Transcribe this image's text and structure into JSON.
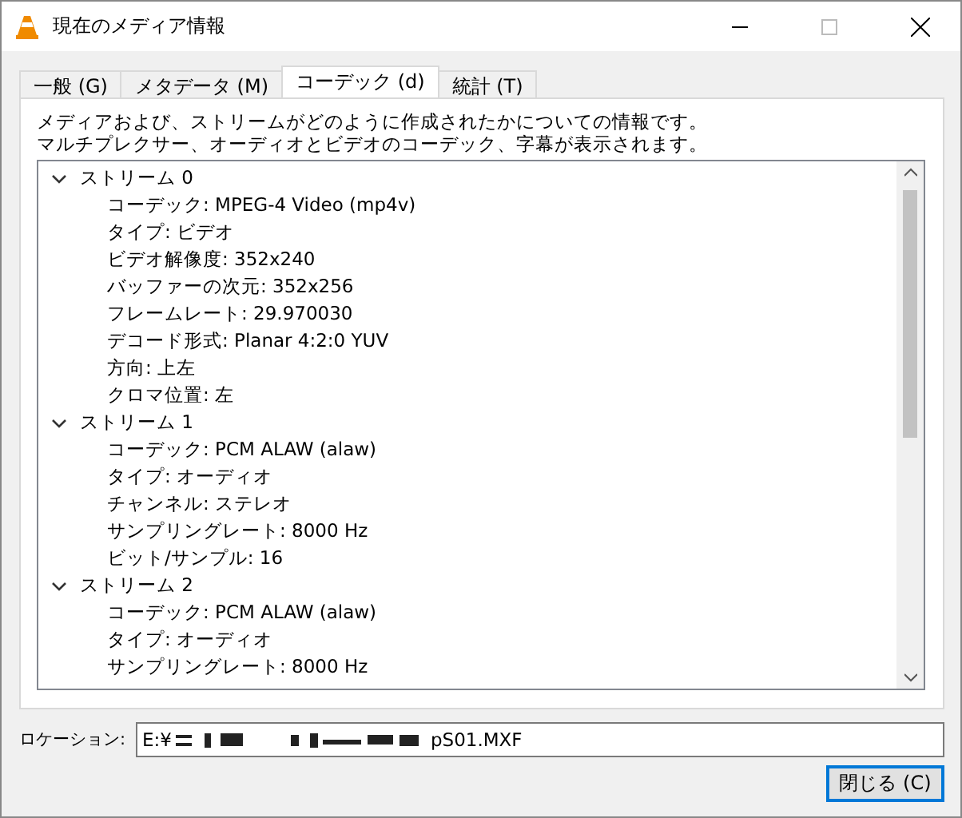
{
  "window": {
    "title": "現在のメディア情報"
  },
  "tabs": [
    {
      "label": "一般 (G)",
      "selected": false
    },
    {
      "label": "メタデータ (M)",
      "selected": false
    },
    {
      "label": "コーデック (d)",
      "selected": true
    },
    {
      "label": "統計 (T)",
      "selected": false
    }
  ],
  "description": [
    "メディアおよび、ストリームがどのように作成されたかについての情報です。",
    "マルチプレクサー、オーディオとビデオのコーデック、字幕が表示されます。"
  ],
  "tree": [
    {
      "label": "ストリーム 0",
      "expanded": true,
      "children": [
        {
          "label": "コーデック: MPEG-4 Video (mp4v)"
        },
        {
          "label": "タイプ: ビデオ"
        },
        {
          "label": "ビデオ解像度: 352x240"
        },
        {
          "label": "バッファーの次元: 352x256"
        },
        {
          "label": "フレームレート: 29.970030"
        },
        {
          "label": "デコード形式: Planar 4:2:0 YUV"
        },
        {
          "label": "方向: 上左"
        },
        {
          "label": "クロマ位置: 左"
        }
      ]
    },
    {
      "label": "ストリーム 1",
      "expanded": true,
      "children": [
        {
          "label": "コーデック: PCM ALAW (alaw)"
        },
        {
          "label": "タイプ: オーディオ"
        },
        {
          "label": "チャンネル: ステレオ"
        },
        {
          "label": "サンプリングレート: 8000 Hz"
        },
        {
          "label": "ビット/サンプル: 16"
        }
      ]
    },
    {
      "label": "ストリーム 2",
      "expanded": true,
      "children": [
        {
          "label": "コーデック: PCM ALAW (alaw)"
        },
        {
          "label": "タイプ: オーディオ"
        },
        {
          "label": "サンプリングレート: 8000 Hz"
        }
      ]
    }
  ],
  "location": {
    "label": "ロケーション:",
    "value_start": "E:¥",
    "value_end": "pS01.MXF"
  },
  "buttons": [
    {
      "label": "閉じる (C)"
    }
  ]
}
